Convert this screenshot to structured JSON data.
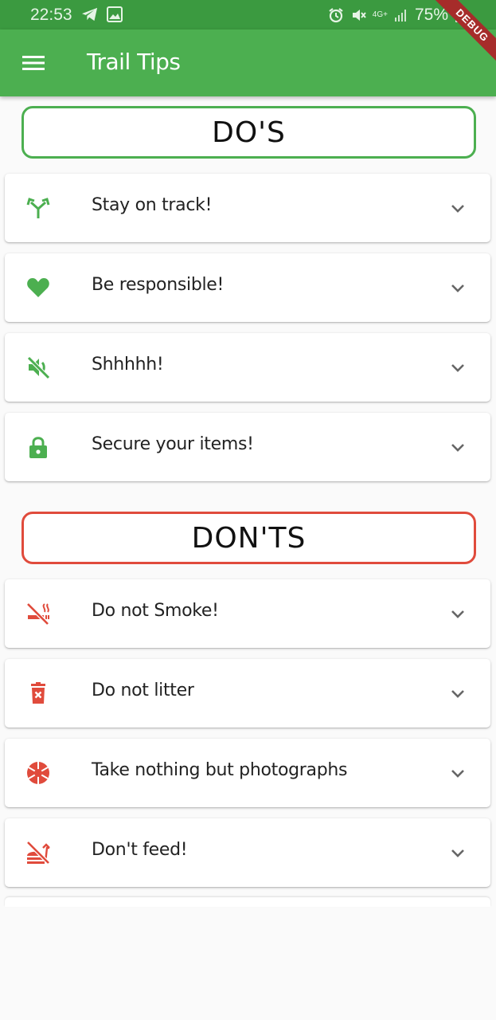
{
  "status_bar": {
    "time": "22:53",
    "network": "4G+",
    "battery": "75%",
    "left_icons": [
      "telegram-icon",
      "image-icon"
    ],
    "right_icons": [
      "alarm-icon",
      "mute-icon",
      "signal-icon",
      "battery-icon"
    ]
  },
  "debug_banner": "DEBUG",
  "app_bar": {
    "title": "Trail Tips",
    "menu_icon": "menu-icon"
  },
  "colors": {
    "primary": "#4caf50",
    "status_bar": "#3b9a40",
    "danger": "#e04b3c",
    "debug": "#a62c2a"
  },
  "dos": {
    "heading": "DO'S",
    "items": [
      {
        "label": "Stay on track!",
        "icon": "fork-arrows-icon"
      },
      {
        "label": "Be responsible!",
        "icon": "heart-icon"
      },
      {
        "label": "Shhhhh!",
        "icon": "volume-off-icon"
      },
      {
        "label": "Secure your items!",
        "icon": "lock-icon"
      }
    ]
  },
  "donts": {
    "heading": "DON'TS",
    "items": [
      {
        "label": "Do not Smoke!",
        "icon": "no-smoking-icon"
      },
      {
        "label": "Do not litter",
        "icon": "delete-forever-icon"
      },
      {
        "label": "Take nothing but photographs",
        "icon": "camera-shutter-icon"
      },
      {
        "label": "Don't feed!",
        "icon": "no-food-icon"
      }
    ]
  }
}
